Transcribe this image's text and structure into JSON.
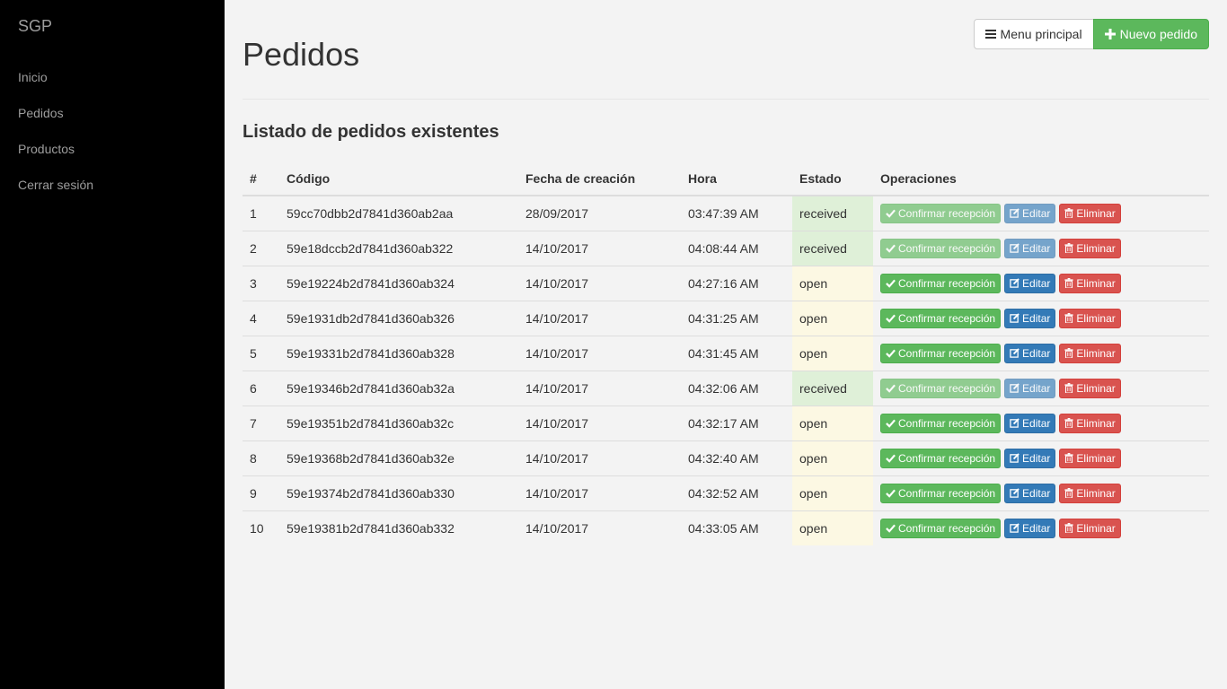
{
  "sidebar": {
    "brand": "SGP",
    "items": [
      {
        "label": "Inicio"
      },
      {
        "label": "Pedidos"
      },
      {
        "label": "Productos"
      },
      {
        "label": "Cerrar sesión"
      }
    ]
  },
  "header": {
    "title": "Pedidos",
    "menu_label": "Menu principal",
    "new_label": "Nuevo pedido"
  },
  "section": {
    "subtitle": "Listado de pedidos existentes"
  },
  "table": {
    "columns": [
      "#",
      "Código",
      "Fecha de creación",
      "Hora",
      "Estado",
      "Operaciones"
    ],
    "actions": {
      "confirm": "Confirmar recepción",
      "edit": "Editar",
      "delete": "Eliminar"
    },
    "rows": [
      {
        "num": "1",
        "code": "59cc70dbb2d7841d360ab2aa",
        "date": "28/09/2017",
        "time": "03:47:39 AM",
        "status": "received"
      },
      {
        "num": "2",
        "code": "59e18dccb2d7841d360ab322",
        "date": "14/10/2017",
        "time": "04:08:44 AM",
        "status": "received"
      },
      {
        "num": "3",
        "code": "59e19224b2d7841d360ab324",
        "date": "14/10/2017",
        "time": "04:27:16 AM",
        "status": "open"
      },
      {
        "num": "4",
        "code": "59e1931db2d7841d360ab326",
        "date": "14/10/2017",
        "time": "04:31:25 AM",
        "status": "open"
      },
      {
        "num": "5",
        "code": "59e19331b2d7841d360ab328",
        "date": "14/10/2017",
        "time": "04:31:45 AM",
        "status": "open"
      },
      {
        "num": "6",
        "code": "59e19346b2d7841d360ab32a",
        "date": "14/10/2017",
        "time": "04:32:06 AM",
        "status": "received"
      },
      {
        "num": "7",
        "code": "59e19351b2d7841d360ab32c",
        "date": "14/10/2017",
        "time": "04:32:17 AM",
        "status": "open"
      },
      {
        "num": "8",
        "code": "59e19368b2d7841d360ab32e",
        "date": "14/10/2017",
        "time": "04:32:40 AM",
        "status": "open"
      },
      {
        "num": "9",
        "code": "59e19374b2d7841d360ab330",
        "date": "14/10/2017",
        "time": "04:32:52 AM",
        "status": "open"
      },
      {
        "num": "10",
        "code": "59e19381b2d7841d360ab332",
        "date": "14/10/2017",
        "time": "04:33:05 AM",
        "status": "open"
      }
    ]
  },
  "colors": {
    "sidebar_bg": "#000000",
    "success": "#5cb85c",
    "primary": "#337ab7",
    "danger": "#d9534f",
    "received_bg": "#dff0d8",
    "open_bg": "#fcf8e3"
  },
  "icons": {
    "menu": "hamburger-icon",
    "new": "plus-icon",
    "confirm": "check-icon",
    "edit": "edit-icon",
    "delete": "trash-icon"
  }
}
